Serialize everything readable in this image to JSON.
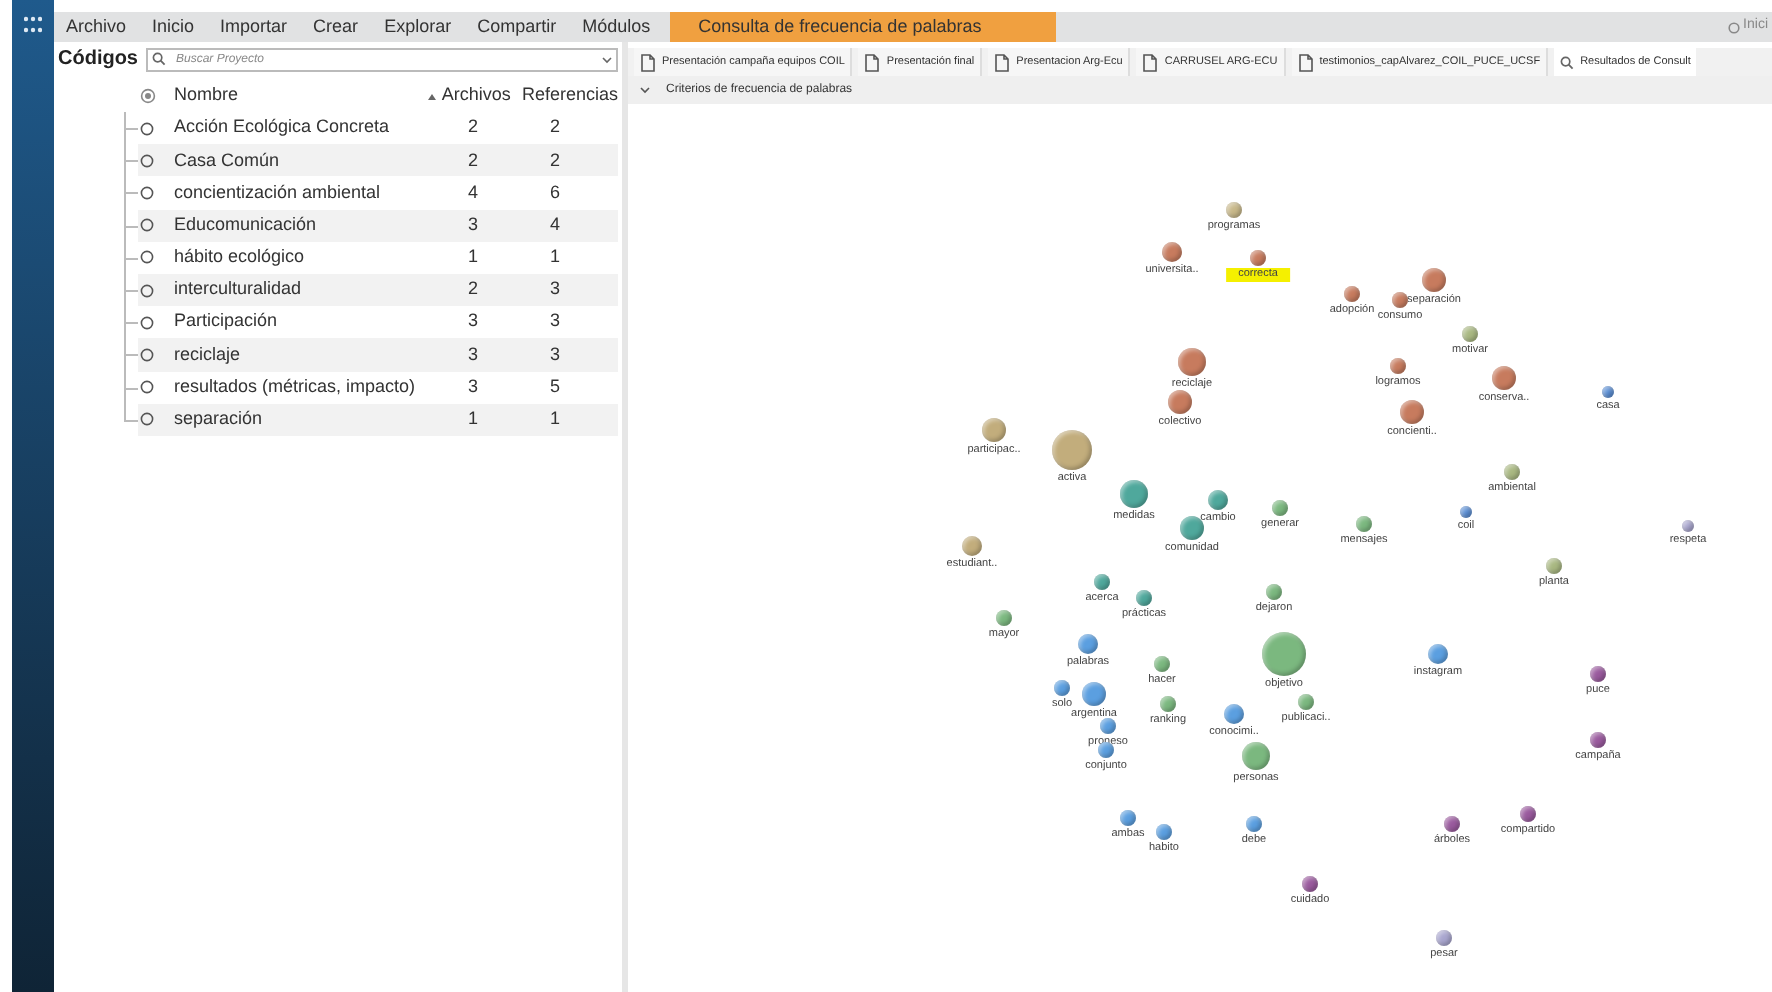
{
  "menu": {
    "items": [
      "Archivo",
      "Inicio",
      "Importar",
      "Crear",
      "Explorar",
      "Compartir",
      "Módulos"
    ],
    "context_tab": {
      "label": "Consulta de frecuencia de palabras",
      "selected": true
    },
    "right_label": "Inici"
  },
  "codes_panel": {
    "title": "Códigos",
    "search": {
      "placeholder": "Buscar Proyecto"
    },
    "columns": [
      "Nombre",
      "Archivos",
      "Referencias"
    ],
    "rows": [
      {
        "name": "Acción Ecológica Concreta",
        "files": "2",
        "references": "2"
      },
      {
        "name": "Casa Común",
        "files": "2",
        "references": "2"
      },
      {
        "name": "concientización ambiental",
        "files": "4",
        "references": "6"
      },
      {
        "name": "Educomunicación",
        "files": "3",
        "references": "4"
      },
      {
        "name": "hábito ecológico",
        "files": "1",
        "references": "1"
      },
      {
        "name": "interculturalidad",
        "files": "2",
        "references": "3"
      },
      {
        "name": "Participación",
        "files": "3",
        "references": "3"
      },
      {
        "name": "reciclaje",
        "files": "3",
        "references": "3"
      },
      {
        "name": "resultados (métricas, impacto)",
        "files": "3",
        "references": "5"
      },
      {
        "name": "separación",
        "files": "1",
        "references": "1"
      }
    ]
  },
  "document_tabs": [
    {
      "label": "Presentación campaña equipos COIL",
      "kind": "document",
      "selected": false
    },
    {
      "label": "Presentación final",
      "kind": "document",
      "selected": false
    },
    {
      "label": "Presentacion Arg-Ecu",
      "kind": "document",
      "selected": false
    },
    {
      "label": "CARRUSEL ARG-ECU",
      "kind": "document",
      "selected": false
    },
    {
      "label": "testimonios_capAlvarez_COIL_PUCE_UCSF",
      "kind": "document",
      "selected": false
    },
    {
      "label": "Resultados de Consult",
      "kind": "query",
      "selected": true
    }
  ],
  "criteria_header": "Criterios de frecuencia de palabras",
  "cluster_words": [
    {
      "word": "programas",
      "color": "#c8b88a",
      "selected": false
    },
    {
      "word": "universita..",
      "color": "#c77b5e",
      "selected": false
    },
    {
      "word": "correcta",
      "color": "#c77b5e",
      "selected": true
    },
    {
      "word": "adopción",
      "color": "#c77b5e",
      "selected": false
    },
    {
      "word": "separación",
      "color": "#c77b5e",
      "selected": false
    },
    {
      "word": "consumo",
      "color": "#c77b5e",
      "selected": false
    },
    {
      "word": "motivar",
      "color": "#a9b882",
      "selected": false
    },
    {
      "word": "reciclaje",
      "color": "#c77b5e",
      "selected": false
    },
    {
      "word": "logramos",
      "color": "#c77b5e",
      "selected": false
    },
    {
      "word": "conserva..",
      "color": "#c77b5e",
      "selected": false
    },
    {
      "word": "casa",
      "color": "#5b8fd6",
      "selected": false
    },
    {
      "word": "colectivo",
      "color": "#c77b5e",
      "selected": false
    },
    {
      "word": "concienti..",
      "color": "#c77b5e",
      "selected": false
    },
    {
      "word": "participac..",
      "color": "#c2ad7c",
      "selected": false
    },
    {
      "word": "activa",
      "color": "#c2ad7c",
      "selected": false
    },
    {
      "word": "ambiental",
      "color": "#a9b882",
      "selected": false
    },
    {
      "word": "medidas",
      "color": "#4fa89c",
      "selected": false
    },
    {
      "word": "cambio",
      "color": "#4fa89c",
      "selected": false
    },
    {
      "word": "generar",
      "color": "#7bb87f",
      "selected": false
    },
    {
      "word": "coil",
      "color": "#5b8fd6",
      "selected": false
    },
    {
      "word": "mensajes",
      "color": "#7bb87f",
      "selected": false
    },
    {
      "word": "respeta",
      "color": "#a9a6cf",
      "selected": false
    },
    {
      "word": "comunidad",
      "color": "#4fa89c",
      "selected": false
    },
    {
      "word": "estudiant..",
      "color": "#c2ad7c",
      "selected": false
    },
    {
      "word": "planta",
      "color": "#a9b882",
      "selected": false
    },
    {
      "word": "acerca",
      "color": "#4fa89c",
      "selected": false
    },
    {
      "word": "prácticas",
      "color": "#4fa89c",
      "selected": false
    },
    {
      "word": "dejaron",
      "color": "#7bb87f",
      "selected": false
    },
    {
      "word": "mayor",
      "color": "#7bb87f",
      "selected": false
    },
    {
      "word": "palabras",
      "color": "#5b9fe0",
      "selected": false
    },
    {
      "word": "hacer",
      "color": "#7bb87f",
      "selected": false
    },
    {
      "word": "objetivo",
      "color": "#7bb87f",
      "selected": false
    },
    {
      "word": "instagram",
      "color": "#5b9fe0",
      "selected": false
    },
    {
      "word": "puce",
      "color": "#9a5a9e",
      "selected": false
    },
    {
      "word": "solo",
      "color": "#5b9fe0",
      "selected": false
    },
    {
      "word": "argentina",
      "color": "#5b9fe0",
      "selected": false
    },
    {
      "word": "ranking",
      "color": "#7bb87f",
      "selected": false
    },
    {
      "word": "conocimi..",
      "color": "#5b9fe0",
      "selected": false
    },
    {
      "word": "publicaci..",
      "color": "#7bb87f",
      "selected": false
    },
    {
      "word": "proneso",
      "color": "#5b9fe0",
      "selected": false
    },
    {
      "word": "conjunto",
      "color": "#5b9fe0",
      "selected": false
    },
    {
      "word": "campaña",
      "color": "#9a5a9e",
      "selected": false
    },
    {
      "word": "personas",
      "color": "#7bb87f",
      "selected": false
    },
    {
      "word": "ambas",
      "color": "#5b9fe0",
      "selected": false
    },
    {
      "word": "habito",
      "color": "#5b9fe0",
      "selected": false
    },
    {
      "word": "debe",
      "color": "#5b9fe0",
      "selected": false
    },
    {
      "word": "árboles",
      "color": "#9a5a9e",
      "selected": false
    },
    {
      "word": "compartido",
      "color": "#9a5a9e",
      "selected": false
    },
    {
      "word": "cuidado",
      "color": "#9a5a9e",
      "selected": false
    },
    {
      "word": "pesar",
      "color": "#a9a6cf",
      "selected": false
    }
  ]
}
